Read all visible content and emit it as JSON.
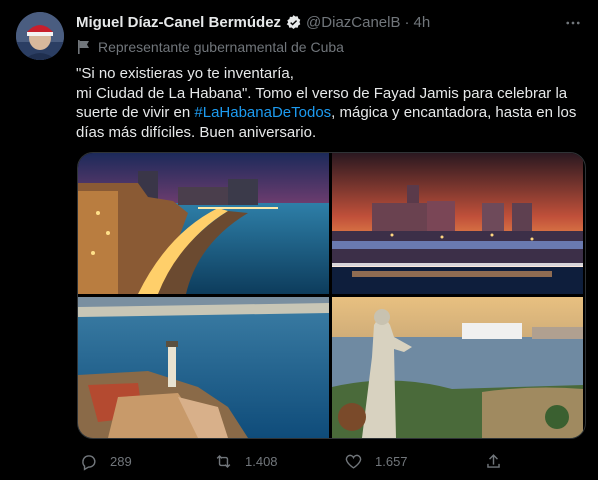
{
  "tweet": {
    "author_name": "Miguel Díaz-Canel Bermúdez",
    "handle": "@DiazCanelB",
    "separator": "·",
    "time": "4h",
    "account_label": "Representante gubernamental de Cuba",
    "text_line1": "\"Si no existieras yo te inventaría,",
    "text_line2": "mi Ciudad de La Habana\". Tomo el verso de Fayad Jamis para celebrar la suerte de vivir en ",
    "hashtag": "#LaHabanaDeTodos",
    "text_line2_end": ", mágica y encantadora, hasta en los días más difíciles. Buen aniversario.",
    "more_icon": "more-dots-icon",
    "photos": [
      {
        "name": "malecon-sunset-photo"
      },
      {
        "name": "havana-skyline-night-photo"
      },
      {
        "name": "morro-lighthouse-photo"
      },
      {
        "name": "cristo-havana-statue-photo"
      }
    ]
  },
  "actions": {
    "reply_count": "289",
    "retweet_count": "1.408",
    "like_count": "1.657"
  },
  "colors": {
    "background": "#000000",
    "text": "#e7e9ea",
    "secondary": "#71767b",
    "link": "#1d9bf0",
    "verified": "#1d9bf0"
  }
}
